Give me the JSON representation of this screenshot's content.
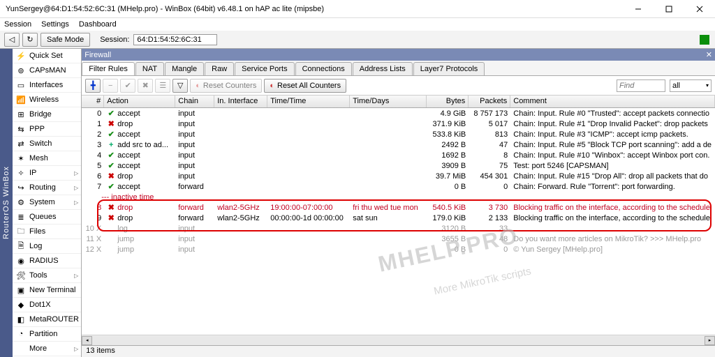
{
  "title": "YunSergey@64:D1:54:52:6C:31 (MHelp.pro) - WinBox (64bit) v6.48.1 on hAP ac lite (mipsbe)",
  "menu": [
    "Session",
    "Settings",
    "Dashboard"
  ],
  "toolbar": {
    "safemode": "Safe Mode",
    "session_lbl": "Session:",
    "session_val": "64:D1:54:52:6C:31"
  },
  "vstrip": "RouterOS WinBox",
  "sidebar": [
    {
      "label": "Quick Set",
      "icon": "⚡",
      "arrow": false
    },
    {
      "label": "CAPsMAN",
      "icon": "⊚",
      "arrow": false
    },
    {
      "label": "Interfaces",
      "icon": "▭",
      "arrow": false
    },
    {
      "label": "Wireless",
      "icon": "📶",
      "arrow": false
    },
    {
      "label": "Bridge",
      "icon": "⊞",
      "arrow": false
    },
    {
      "label": "PPP",
      "icon": "⇆",
      "arrow": false
    },
    {
      "label": "Switch",
      "icon": "⇄",
      "arrow": false
    },
    {
      "label": "Mesh",
      "icon": "✶",
      "arrow": false
    },
    {
      "label": "IP",
      "icon": "✧",
      "arrow": true
    },
    {
      "label": "Routing",
      "icon": "↪",
      "arrow": true
    },
    {
      "label": "System",
      "icon": "⚙",
      "arrow": true
    },
    {
      "label": "Queues",
      "icon": "≣",
      "arrow": false
    },
    {
      "label": "Files",
      "icon": "🗀",
      "arrow": false
    },
    {
      "label": "Log",
      "icon": "🗎",
      "arrow": false
    },
    {
      "label": "RADIUS",
      "icon": "◉",
      "arrow": false
    },
    {
      "label": "Tools",
      "icon": "🛠",
      "arrow": true
    },
    {
      "label": "New Terminal",
      "icon": "▣",
      "arrow": false
    },
    {
      "label": "Dot1X",
      "icon": "◆",
      "arrow": false
    },
    {
      "label": "MetaROUTER",
      "icon": "◧",
      "arrow": false
    },
    {
      "label": "Partition",
      "icon": "◔",
      "arrow": false
    },
    {
      "label": "More",
      "icon": "",
      "arrow": true
    }
  ],
  "panel_title": "Firewall",
  "tabs": [
    "Filter Rules",
    "NAT",
    "Mangle",
    "Raw",
    "Service Ports",
    "Connections",
    "Address Lists",
    "Layer7 Protocols"
  ],
  "fwtb": {
    "reset": "Reset Counters",
    "resetall": "Reset All Counters",
    "find": "Find",
    "all": "all"
  },
  "columns": [
    "#",
    "Action",
    "Chain",
    "In. Interface",
    "Time/Time",
    "Time/Days",
    "Bytes",
    "Packets",
    "Comment"
  ],
  "group_lbl": "--- inactive time",
  "rows": [
    {
      "n": "0",
      "ai": "✔",
      "ac": "ok",
      "act": "accept",
      "chain": "input",
      "iface": "",
      "tt": "",
      "td": "",
      "bytes": "4.9 GiB",
      "pkts": "8 757 173",
      "cmt": "Chain: Input. Rule #0 \"Trusted\": accept packets connectio",
      "cls": ""
    },
    {
      "n": "1",
      "ai": "✖",
      "ac": "no",
      "act": "drop",
      "chain": "input",
      "iface": "",
      "tt": "",
      "td": "",
      "bytes": "371.9 KiB",
      "pkts": "5 017",
      "cmt": "Chain: Input. Rule #1 \"Drop Invalid Packet\": drop packets",
      "cls": ""
    },
    {
      "n": "2",
      "ai": "✔",
      "ac": "ok",
      "act": "accept",
      "chain": "input",
      "iface": "",
      "tt": "",
      "td": "",
      "bytes": "533.8 KiB",
      "pkts": "813",
      "cmt": "Chain: Input. Rule #3 \"ICMP\": accept icmp packets.",
      "cls": ""
    },
    {
      "n": "3",
      "ai": "+",
      "ac": "plus",
      "act": "add src to ad...",
      "chain": "input",
      "iface": "",
      "tt": "",
      "td": "",
      "bytes": "2492 B",
      "pkts": "47",
      "cmt": "Chain: Input. Rule #5 \"Block TCP port scanning\": add a de",
      "cls": ""
    },
    {
      "n": "4",
      "ai": "✔",
      "ac": "ok",
      "act": "accept",
      "chain": "input",
      "iface": "",
      "tt": "",
      "td": "",
      "bytes": "1692 B",
      "pkts": "8",
      "cmt": "Chain: Input. Rule #10 \"Winbox\": accept Winbox port con.",
      "cls": ""
    },
    {
      "n": "5",
      "ai": "✔",
      "ac": "ok",
      "act": "accept",
      "chain": "input",
      "iface": "",
      "tt": "",
      "td": "",
      "bytes": "3909 B",
      "pkts": "75",
      "cmt": "Test: port 5246 [CAPSMAN]",
      "cls": ""
    },
    {
      "n": "6",
      "ai": "✖",
      "ac": "no",
      "act": "drop",
      "chain": "input",
      "iface": "",
      "tt": "",
      "td": "",
      "bytes": "39.7 MiB",
      "pkts": "454 301",
      "cmt": "Chain: Input. Rule #15 \"Drop All\": drop all packets that do",
      "cls": ""
    },
    {
      "n": "7",
      "ai": "✔",
      "ac": "ok",
      "act": "accept",
      "chain": "forward",
      "iface": "",
      "tt": "",
      "td": "",
      "bytes": "0 B",
      "pkts": "0",
      "cmt": "Chain: Forward. Rule \"Torrent\": port forwarding.",
      "cls": ""
    }
  ],
  "rows2": [
    {
      "n": "8",
      "ai": "✖",
      "ac": "no",
      "act": "drop",
      "chain": "forward",
      "iface": "wlan2-5GHz",
      "tt": "19:00:00-07:00:00",
      "td": "fri thu wed tue mon",
      "bytes": "540.5 KiB",
      "pkts": "3 730",
      "cmt": "Blocking traffic on the interface, according to the schedule.",
      "cls": "red"
    },
    {
      "n": "9",
      "ai": "✖",
      "ac": "no",
      "act": "drop",
      "chain": "forward",
      "iface": "wlan2-5GHz",
      "tt": "00:00:00-1d 00:00:00",
      "td": "sat sun",
      "bytes": "179.0 KiB",
      "pkts": "2 133",
      "cmt": "Blocking traffic on the interface, according to the schedule.",
      "cls": ""
    },
    {
      "n": "10 X",
      "ai": "",
      "ac": "",
      "act": "log",
      "chain": "input",
      "iface": "",
      "tt": "",
      "td": "",
      "bytes": "3120 B",
      "pkts": "33",
      "cmt": "",
      "cls": "grey"
    },
    {
      "n": "11 X",
      "ai": "",
      "ac": "",
      "act": "jump",
      "chain": "input",
      "iface": "",
      "tt": "",
      "td": "",
      "bytes": "3655 B",
      "pkts": "48",
      "cmt": "Do you want more articles on MikroTik? >>> MHelp.pro",
      "cls": "grey"
    },
    {
      "n": "12 X",
      "ai": "",
      "ac": "",
      "act": "jump",
      "chain": "input",
      "iface": "",
      "tt": "",
      "td": "",
      "bytes": "0 B",
      "pkts": "0",
      "cmt": "© Yun Sergey [MHelp.pro]",
      "cls": "grey"
    }
  ],
  "status": "13 items",
  "watermark": "MHELP.PRO",
  "watermark2": "More MikroTik scripts"
}
